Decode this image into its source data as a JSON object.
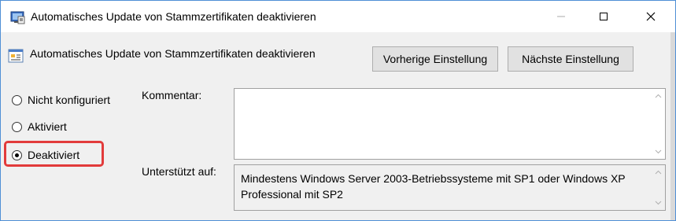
{
  "window": {
    "title": "Automatisches Update von Stammzertifikaten deaktivieren",
    "icons": {
      "app": "policy-settings-icon",
      "minimize": "minimize-icon",
      "maximize": "maximize-icon",
      "close": "close-icon"
    }
  },
  "header": {
    "policy_title": "Automatisches Update von Stammzertifikaten deaktivieren",
    "policy_icon": "policy-setting-icon",
    "prev_button": "Vorherige Einstellung",
    "next_button": "Nächste Einstellung"
  },
  "options": {
    "not_configured": "Nicht konfiguriert",
    "enabled": "Aktiviert",
    "disabled": "Deaktiviert",
    "selected": "disabled",
    "highlight_color": "#e23b3b"
  },
  "comment": {
    "label": "Kommentar:",
    "value": ""
  },
  "supported": {
    "label": "Unterstützt auf:",
    "text": "Mindestens Windows Server 2003-Betriebssysteme mit SP1 oder Windows XP Professional mit SP2"
  }
}
